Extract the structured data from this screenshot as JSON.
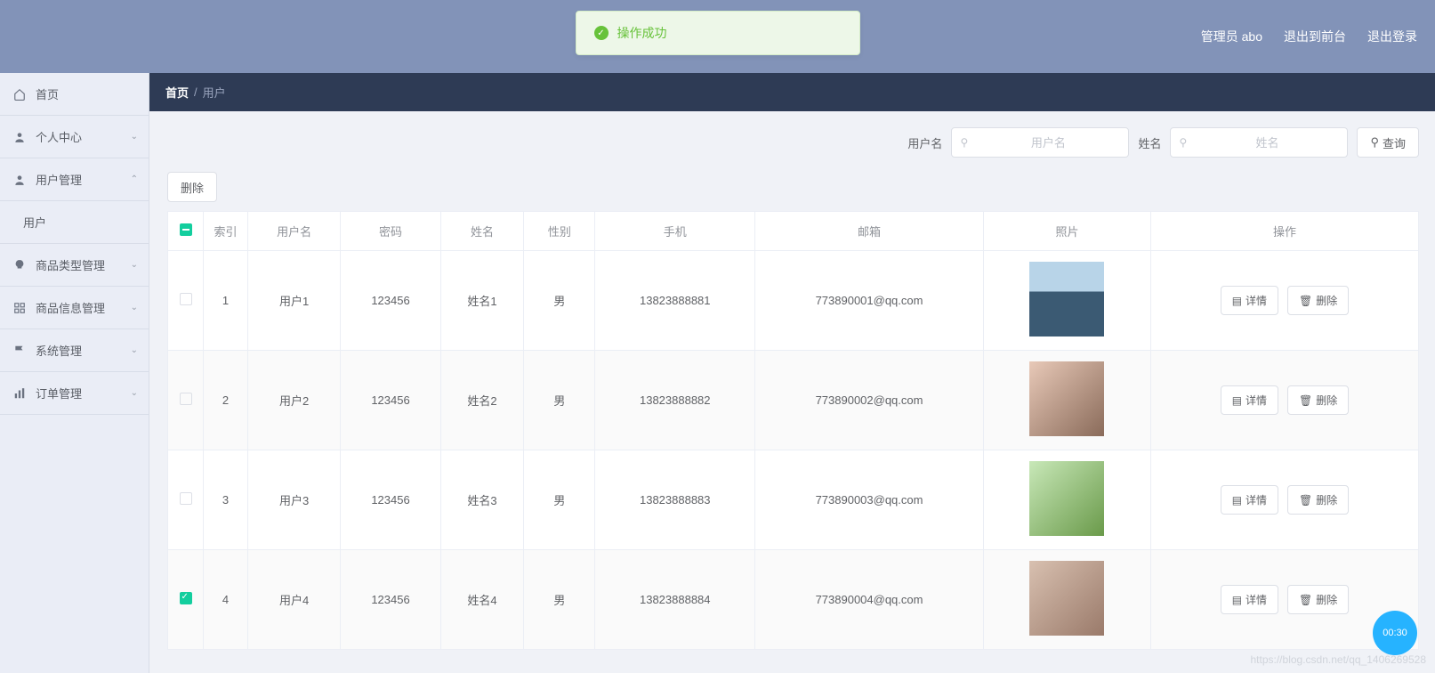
{
  "toast": {
    "text": "操作成功"
  },
  "header": {
    "admin_label": "管理员 abo",
    "to_front": "退出到前台",
    "logout": "退出登录"
  },
  "sidebar": {
    "home": "首页",
    "personal": "个人中心",
    "user_mgmt": "用户管理",
    "user_sub": "用户",
    "cat_mgmt": "商品类型管理",
    "prod_mgmt": "商品信息管理",
    "sys_mgmt": "系统管理",
    "order_mgmt": "订单管理"
  },
  "breadcrumb": {
    "root": "首页",
    "current": "用户"
  },
  "filters": {
    "username_label": "用户名",
    "username_ph": "用户名",
    "name_label": "姓名",
    "name_ph": "姓名",
    "search_btn": "查询"
  },
  "toolbar": {
    "delete_btn": "删除"
  },
  "table": {
    "headers": {
      "index": "索引",
      "username": "用户名",
      "password": "密码",
      "name": "姓名",
      "gender": "性别",
      "phone": "手机",
      "email": "邮箱",
      "photo": "照片",
      "ops": "操作"
    },
    "row_btns": {
      "detail": "详情",
      "delete": "删除"
    },
    "rows": [
      {
        "idx": "1",
        "uname": "用户1",
        "pwd": "123456",
        "name": "姓名1",
        "gender": "男",
        "phone": "13823888881",
        "email": "773890001@qq.com",
        "checked": false
      },
      {
        "idx": "2",
        "uname": "用户2",
        "pwd": "123456",
        "name": "姓名2",
        "gender": "男",
        "phone": "13823888882",
        "email": "773890002@qq.com",
        "checked": false
      },
      {
        "idx": "3",
        "uname": "用户3",
        "pwd": "123456",
        "name": "姓名3",
        "gender": "男",
        "phone": "13823888883",
        "email": "773890003@qq.com",
        "checked": false
      },
      {
        "idx": "4",
        "uname": "用户4",
        "pwd": "123456",
        "name": "姓名4",
        "gender": "男",
        "phone": "13823888884",
        "email": "773890004@qq.com",
        "checked": true
      }
    ]
  },
  "watermark": "https://blog.csdn.net/qq_1406269528",
  "timer": "00:30"
}
